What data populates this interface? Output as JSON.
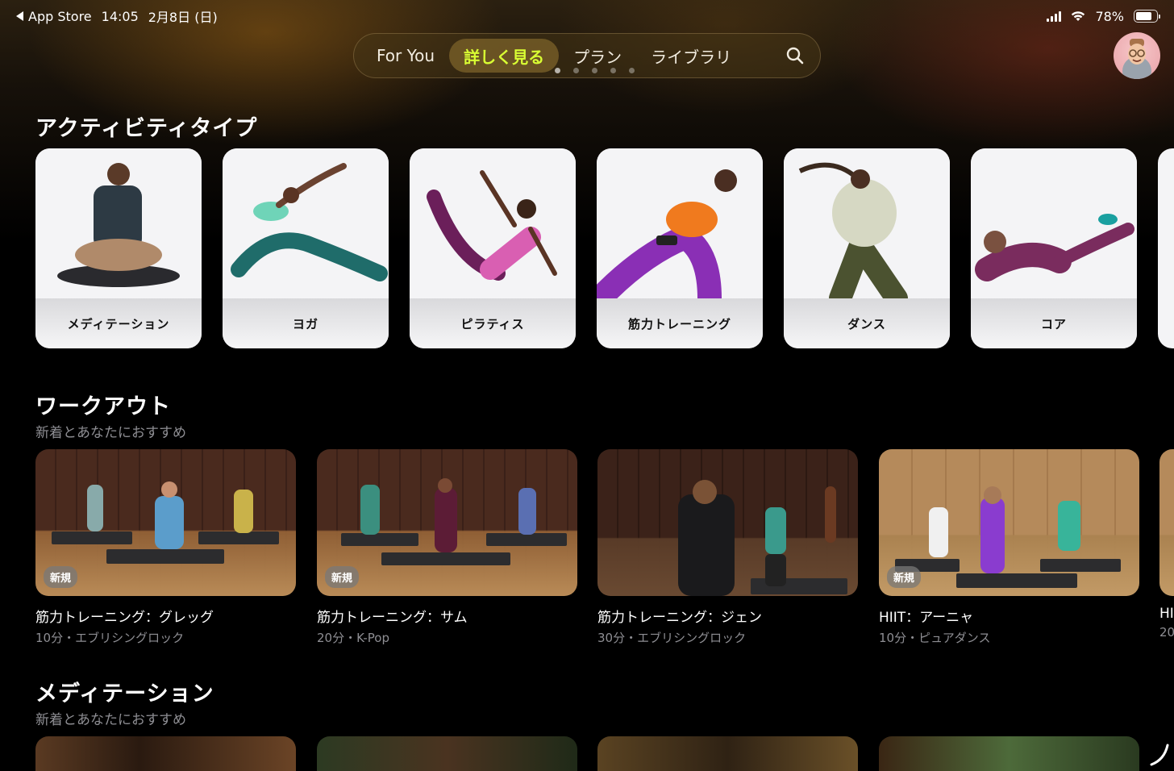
{
  "status_bar": {
    "back_app": "App Store",
    "time": "14:05",
    "date": "2月8日 (日)",
    "battery": "78%",
    "battery_level": 0.78
  },
  "nav": {
    "tabs": [
      {
        "label": "For You",
        "active": false
      },
      {
        "label": "詳しく見る",
        "active": true
      },
      {
        "label": "プラン",
        "active": false
      },
      {
        "label": "ライブラリ",
        "active": false
      }
    ],
    "search_icon": "search-icon",
    "accent_color": "#d9ff33"
  },
  "activity_section": {
    "title": "アクティビティタイプ",
    "items": [
      {
        "label": "メディテーション"
      },
      {
        "label": "ヨガ"
      },
      {
        "label": "ピラティス"
      },
      {
        "label": "筋力トレーニング"
      },
      {
        "label": "ダンス"
      },
      {
        "label": "コア"
      }
    ]
  },
  "workout_section": {
    "title": "ワークアウト",
    "subtitle": "新着とあなたにおすすめ",
    "items": [
      {
        "title": "筋力トレーニング：グレッグ",
        "meta": "10分・エブリシングロック",
        "badge": "新規"
      },
      {
        "title": "筋力トレーニング：サム",
        "meta": "20分・K-Pop",
        "badge": "新規"
      },
      {
        "title": "筋力トレーニング：ジェン",
        "meta": "30分・エブリシングロック",
        "badge": ""
      },
      {
        "title": "HIIT：アーニャ",
        "meta": "10分・ピュアダンス",
        "badge": "新規"
      },
      {
        "title": "HI",
        "meta": "20",
        "badge": ""
      }
    ]
  },
  "meditation_section": {
    "title": "メディテーション",
    "subtitle": "新着とあなたにおすすめ"
  }
}
